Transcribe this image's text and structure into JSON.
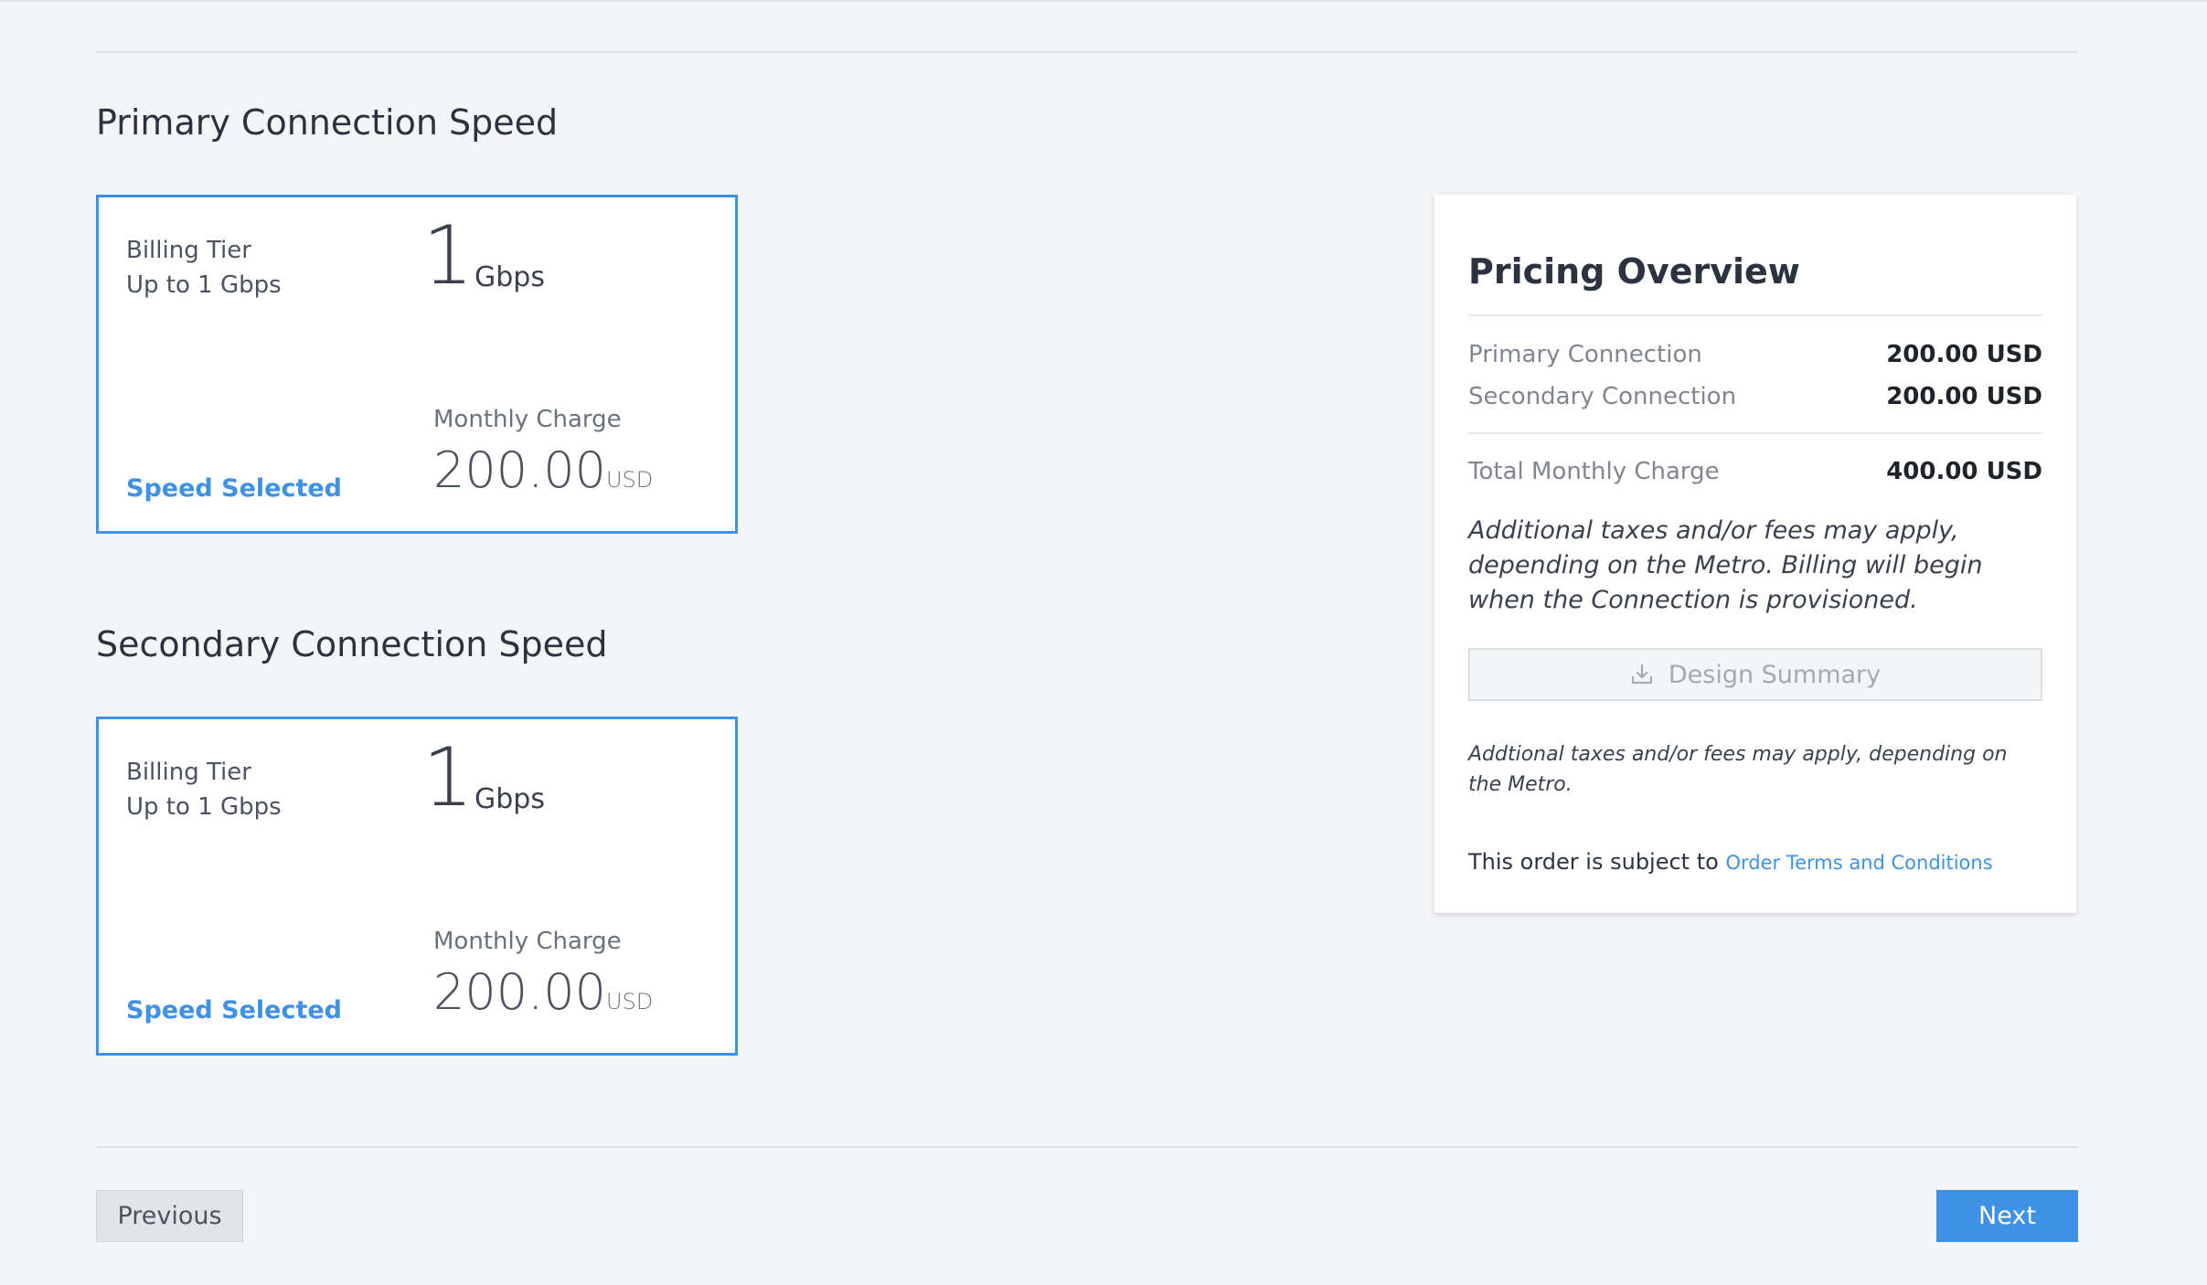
{
  "primary": {
    "section_title": "Primary Connection Speed",
    "billing_tier_label": "Billing Tier",
    "tier_range": "Up to 1 Gbps",
    "speed_value": "1",
    "speed_unit": "Gbps",
    "charge_label": "Monthly Charge",
    "charge_amount": "200.00",
    "charge_currency": "USD",
    "selected_label": "Speed Selected"
  },
  "secondary": {
    "section_title": "Secondary Connection Speed",
    "billing_tier_label": "Billing Tier",
    "tier_range": "Up to 1 Gbps",
    "speed_value": "1",
    "speed_unit": "Gbps",
    "charge_label": "Monthly Charge",
    "charge_amount": "200.00",
    "charge_currency": "USD",
    "selected_label": "Speed Selected"
  },
  "pricing": {
    "title": "Pricing Overview",
    "lines": [
      {
        "label": "Primary Connection",
        "value": "200.00 USD"
      },
      {
        "label": "Secondary Connection",
        "value": "200.00 USD"
      }
    ],
    "total": {
      "label": "Total Monthly Charge",
      "value": "400.00 USD"
    },
    "note": "Additional taxes and/or fees may apply, depending on the Metro. Billing will begin when the Connection is provisioned.",
    "design_summary_label": "Design Summary",
    "small_note": "Addtional taxes and/or fees may apply, depending on the Metro.",
    "terms_prefix": "This order is subject to",
    "terms_link": "Order Terms and Conditions"
  },
  "nav": {
    "previous_label": "Previous",
    "next_label": "Next"
  },
  "colors": {
    "accent": "#3f91e6",
    "background": "#f4f5f7"
  }
}
